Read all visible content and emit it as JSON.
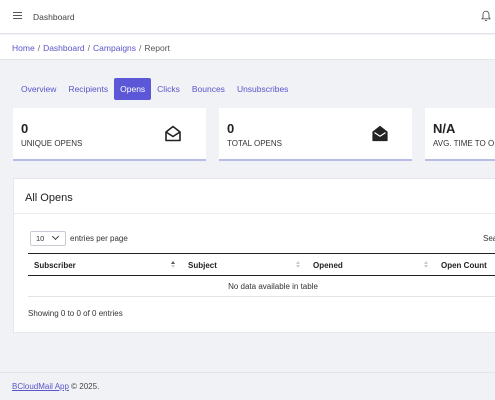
{
  "topbar": {
    "title": "Dashboard",
    "menu_icon": "hamburger-icon",
    "notify_icon": "bell-icon"
  },
  "breadcrumb": {
    "items": [
      "Home",
      "Dashboard",
      "Campaigns"
    ],
    "current": "Report",
    "separator": "/"
  },
  "tabs": [
    {
      "label": "Overview",
      "active": false
    },
    {
      "label": "Recipients",
      "active": false
    },
    {
      "label": "Opens",
      "active": true
    },
    {
      "label": "Clicks",
      "active": false
    },
    {
      "label": "Bounces",
      "active": false
    },
    {
      "label": "Unsubscribes",
      "active": false
    }
  ],
  "stats": [
    {
      "value": "0",
      "label": "UNIQUE OPENS",
      "icon": "envelope-open-outline-icon"
    },
    {
      "value": "0",
      "label": "TOTAL OPENS",
      "icon": "envelope-open-filled-icon"
    },
    {
      "value": "N/A",
      "label": "AVG. TIME TO O",
      "icon": ""
    }
  ],
  "table": {
    "title": "All Opens",
    "page_length": "10",
    "page_length_label": "entries per page",
    "search_label": "Sea",
    "columns": [
      "Subscriber",
      "Subject",
      "Opened",
      "Open Count"
    ],
    "empty_message": "No data available in table",
    "info": "Showing 0 to 0 of 0 entries"
  },
  "footer": {
    "brand": "BCloudMail App",
    "text": "© 2025."
  },
  "colors": {
    "accent": "#5b57d6",
    "link": "#5a55c9",
    "background": "#f0f2f6",
    "stat_border": "#b8bce6"
  }
}
